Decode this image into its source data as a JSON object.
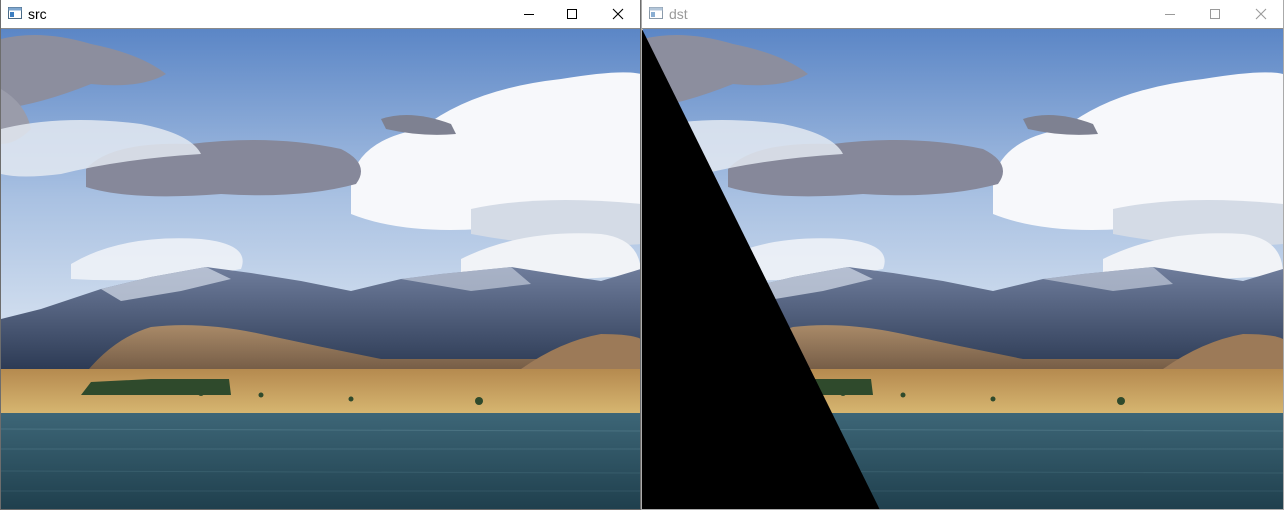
{
  "windows": [
    {
      "title": "src",
      "active": true
    },
    {
      "title": "dst",
      "active": false
    }
  ],
  "controls": {
    "minimize": "minimize-icon",
    "maximize": "maximize-icon",
    "close": "close-icon"
  },
  "colors": {
    "titlebar_bg": "#ffffff",
    "active_title_text": "#000000",
    "inactive_title_text": "#9a9a9a",
    "sky_top": "#4f7fc4",
    "water": "#2f5766",
    "grassland": "#c9a25c",
    "mountain": "#394a68",
    "mask_fill": "#000000"
  }
}
